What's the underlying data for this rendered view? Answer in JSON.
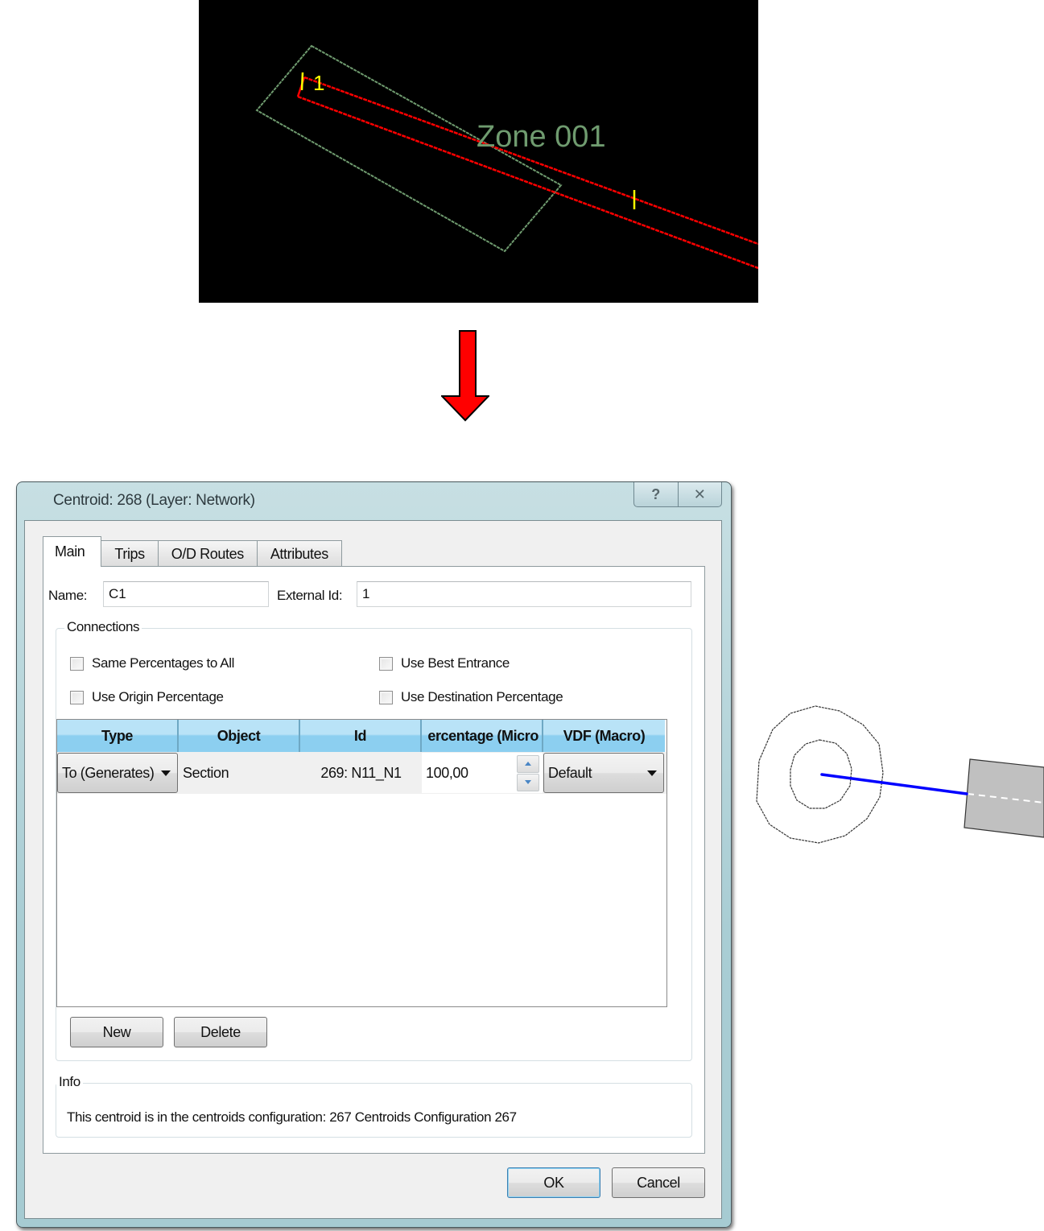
{
  "map_view": {
    "zone_label": "Zone 001",
    "node_label": "1",
    "colors": {
      "background": "#000000",
      "zone_outline": "#6f9b6f",
      "section": "#ff0000",
      "marker": "#ffff00"
    }
  },
  "arrow": {
    "color": "#ff0000"
  },
  "dialog": {
    "title": "Centroid: 268 (Layer: Network)",
    "help_icon": "?",
    "close_icon": "✕",
    "tabs": [
      {
        "label": "Main",
        "active": true
      },
      {
        "label": "Trips",
        "active": false
      },
      {
        "label": "O/D Routes",
        "active": false
      },
      {
        "label": "Attributes",
        "active": false
      }
    ],
    "name_label": "Name:",
    "name_value": "C1",
    "external_id_label": "External Id:",
    "external_id_value": "1",
    "connections": {
      "title": "Connections",
      "checkboxes": [
        {
          "label": "Same Percentages to All",
          "checked": false
        },
        {
          "label": "Use Best Entrance",
          "checked": false
        },
        {
          "label": "Use Origin Percentage",
          "checked": false
        },
        {
          "label": "Use Destination Percentage",
          "checked": false
        }
      ],
      "table": {
        "columns": [
          "Type",
          "Object",
          "Id",
          "ercentage (Micro",
          "VDF (Macro)"
        ],
        "rows": [
          {
            "type": "To (Generates)",
            "object": "Section",
            "id": "269: N11_N1",
            "percentage": "100,00",
            "vdf": "Default"
          }
        ]
      },
      "new_button": "New",
      "delete_button": "Delete"
    },
    "info": {
      "title": "Info",
      "text": "This centroid is in the centroids configuration: 267 Centroids Configuration 267"
    },
    "ok_button": "OK",
    "cancel_button": "Cancel"
  },
  "diagram": {
    "colors": {
      "connector": "#0000ff",
      "section_fill": "#c0c0c0",
      "outline": "#333333"
    }
  }
}
